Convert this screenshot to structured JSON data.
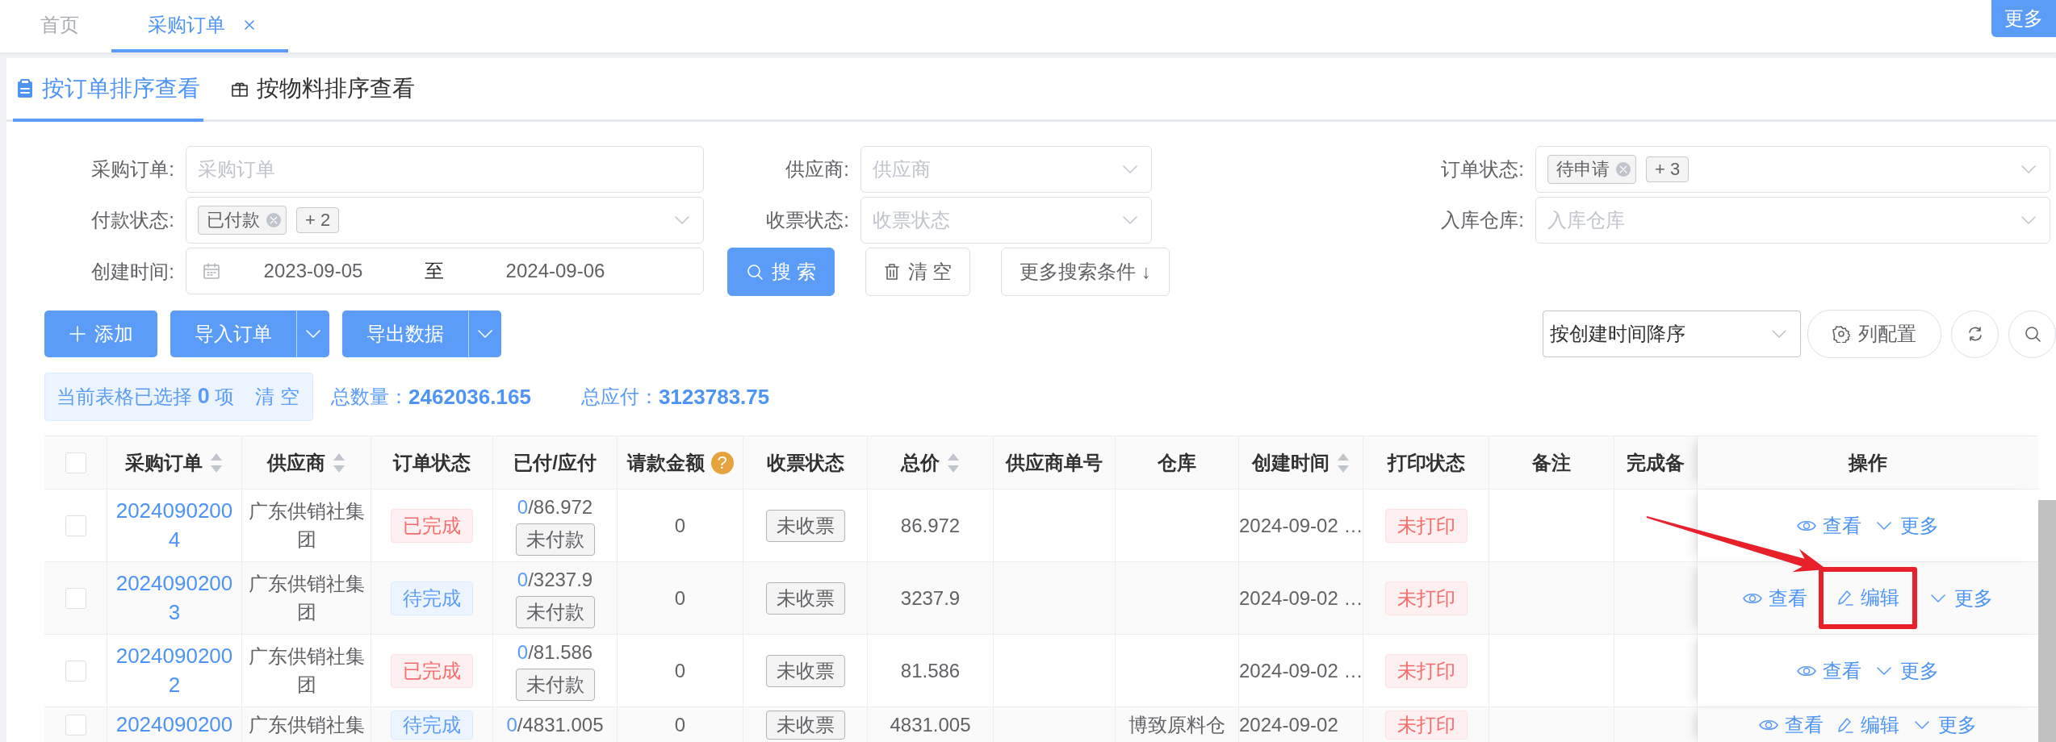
{
  "top_tabs": [
    {
      "label": "首页",
      "selected": false,
      "closable": false
    },
    {
      "label": "采购订单",
      "selected": true,
      "closable": true
    }
  ],
  "more_button": "更多",
  "view_tabs": [
    {
      "label": "按订单排序查看",
      "kind": "order",
      "selected": true
    },
    {
      "label": "按物料排序查看",
      "kind": "material",
      "selected": false
    }
  ],
  "filters": [
    {
      "label": "采购订单:",
      "kind": "text",
      "placeholder": "采购订单"
    },
    {
      "label": "供应商:",
      "kind": "select",
      "placeholder": "供应商"
    },
    {
      "label": "订单状态:",
      "kind": "tags",
      "tags": [
        "待申请"
      ],
      "more": "+ 3"
    },
    {
      "label": "付款状态:",
      "kind": "tags",
      "tags": [
        "已付款"
      ],
      "more": "+ 2"
    },
    {
      "label": "收票状态:",
      "kind": "select",
      "placeholder": "收票状态"
    },
    {
      "label": "入库仓库:",
      "kind": "select",
      "placeholder": "入库仓库"
    }
  ],
  "date_range": {
    "label": "创建时间:",
    "start": "2023-09-05",
    "separator": "至",
    "end": "2024-09-06"
  },
  "search_buttons": [
    {
      "label": "搜 索",
      "kind": "search"
    },
    {
      "label": "清 空",
      "kind": "clear"
    },
    {
      "label": "更多搜索条件 ↓",
      "kind": "more"
    }
  ],
  "actions": [
    {
      "label": "添加",
      "kind": "add"
    },
    {
      "label": "导入订单",
      "kind": "split"
    },
    {
      "label": "导出数据",
      "kind": "split"
    }
  ],
  "sort_select": {
    "value": "按创建时间降序"
  },
  "column_config": "列配置",
  "selection": {
    "text": "当前表格已选择 **0** 项",
    "clear": "清 空"
  },
  "totals": [
    {
      "label": "总数量：",
      "value": "2462036.165"
    },
    {
      "label": "总应付：",
      "value": "3123783.75"
    }
  ],
  "table": {
    "all_checked": false,
    "columns": [
      {
        "label": "采购订单",
        "sortable": true
      },
      {
        "label": "供应商",
        "sortable": true
      },
      {
        "label": "订单状态",
        "sortable": false
      },
      {
        "label": "已付/应付",
        "sortable": false
      },
      {
        "label": "请款金额",
        "sortable": false,
        "help": "?"
      },
      {
        "label": "收票状态",
        "sortable": false
      },
      {
        "label": "总价",
        "sortable": true
      },
      {
        "label": "供应商单号",
        "sortable": false
      },
      {
        "label": "仓库",
        "sortable": false
      },
      {
        "label": "创建时间",
        "sortable": true
      },
      {
        "label": "打印状态",
        "sortable": false
      },
      {
        "label": "备注",
        "sortable": false
      },
      {
        "label": "完成备",
        "sortable": false
      },
      {
        "label": "操作",
        "sortable": false
      }
    ],
    "rows": [
      {
        "checked": false,
        "order": "20240902004",
        "supplier": "广东供销社集团",
        "status": {
          "text": "已完成",
          "kind": "done"
        },
        "paid": "0",
        "payable": "/86.972",
        "payment_status": "未付款",
        "request_amount": "0",
        "invoice_status": "未收票",
        "total": "86.972",
        "created": "2024-09-02 …",
        "print_status": "未打印",
        "operations": [
          {
            "label": "查看",
            "kind": "view",
            "highlighted": false
          },
          {
            "label": "更多",
            "kind": "more",
            "highlighted": false
          }
        ]
      },
      {
        "checked": false,
        "order": "20240902003",
        "supplier": "广东供销社集团",
        "status": {
          "text": "待完成",
          "kind": "pending"
        },
        "paid": "0",
        "payable": "/3237.9",
        "payment_status": "未付款",
        "request_amount": "0",
        "invoice_status": "未收票",
        "total": "3237.9",
        "created": "2024-09-02 …",
        "print_status": "未打印",
        "operations": [
          {
            "label": "查看",
            "kind": "view",
            "highlighted": false
          },
          {
            "label": "编辑",
            "kind": "edit",
            "highlighted": true
          },
          {
            "label": "更多",
            "kind": "more",
            "highlighted": false
          }
        ]
      },
      {
        "checked": false,
        "order": "20240902002",
        "supplier": "广东供销社集团",
        "status": {
          "text": "已完成",
          "kind": "done"
        },
        "paid": "0",
        "payable": "/81.586",
        "payment_status": "未付款",
        "request_amount": "0",
        "invoice_status": "未收票",
        "total": "81.586",
        "created": "2024-09-02 …",
        "print_status": "未打印",
        "operations": [
          {
            "label": "查看",
            "kind": "view",
            "highlighted": false
          },
          {
            "label": "更多",
            "kind": "more",
            "highlighted": false
          }
        ]
      },
      {
        "checked": false,
        "order": "2024090200",
        "supplier": "广东供销社集",
        "status": {
          "text": "待完成",
          "kind": "pending"
        },
        "paid": "0",
        "payable": "/4831.005",
        "request_amount": "0",
        "invoice_status": "未收票",
        "total": "4831.005",
        "warehouse": "博致原料仓",
        "created": "2024-09-02",
        "print_status": "未打印",
        "operations": [
          {
            "label": "查看",
            "kind": "view",
            "highlighted": false
          },
          {
            "label": "编辑",
            "kind": "edit",
            "highlighted": false
          },
          {
            "label": "更多",
            "kind": "more",
            "highlighted": false
          }
        ]
      }
    ]
  }
}
